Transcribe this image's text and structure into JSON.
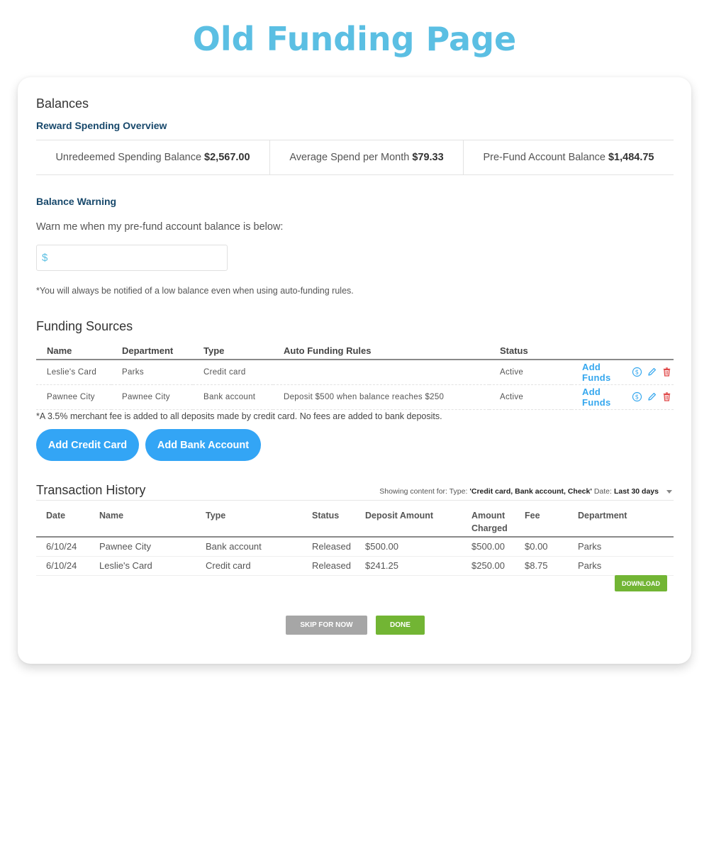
{
  "page": {
    "title": "Old Funding Page"
  },
  "colors": {
    "title": "#5bbfe3",
    "accent": "#33a5f5",
    "link": "#35a7ee",
    "subheading": "#17486b",
    "success": "#72b534",
    "neutral_button": "#a6a6a6",
    "danger": "#e04848"
  },
  "balances": {
    "heading": "Balances",
    "overview_heading": "Reward Spending Overview",
    "items": [
      {
        "label": "Unredeemed Spending Balance",
        "value": "$2,567.00"
      },
      {
        "label": "Average Spend per Month",
        "value": "$79.33"
      },
      {
        "label": "Pre-Fund Account Balance",
        "value": "$1,484.75"
      }
    ]
  },
  "balance_warning": {
    "heading": "Balance Warning",
    "label": "Warn me when my pre-fund account balance is below:",
    "currency_symbol": "$",
    "value": "",
    "note": "*You will always be notified of a low balance even when using auto-funding rules."
  },
  "funding_sources": {
    "heading": "Funding Sources",
    "columns": [
      "Name",
      "Department",
      "Type",
      "Auto Funding Rules",
      "Status"
    ],
    "rows": [
      {
        "name": "Leslie's Card",
        "department": "Parks",
        "type": "Credit card",
        "rules": "",
        "status": "Active",
        "action_label": "Add Funds"
      },
      {
        "name": "Pawnee City",
        "department": "Pawnee City",
        "type": "Bank account",
        "rules": "Deposit $500 when balance reaches $250",
        "status": "Active",
        "action_label": "Add Funds"
      }
    ],
    "icons": [
      "dollar-circle-icon",
      "pencil-icon",
      "trash-icon"
    ],
    "fee_note": "*A 3.5% merchant fee is added to all deposits made by credit card. No fees are added to bank deposits.",
    "add_credit_card_label": "Add Credit Card",
    "add_bank_account_label": "Add Bank Account"
  },
  "transactions": {
    "heading": "Transaction History",
    "filter": {
      "prefix": "Showing content for: Type:",
      "type_value": "'Credit card, Bank account, Check'",
      "date_label": "Date:",
      "date_value": "Last 30 days"
    },
    "columns": [
      "Date",
      "Name",
      "Type",
      "Status",
      "Deposit Amount",
      "Amount Charged",
      "Fee",
      "Department"
    ],
    "rows": [
      {
        "date": "6/10/24",
        "name": "Pawnee City",
        "type": "Bank account",
        "status": "Released",
        "deposit": "$500.00",
        "charged": "$500.00",
        "fee": "$0.00",
        "department": "Parks"
      },
      {
        "date": "6/10/24",
        "name": "Leslie's Card",
        "type": "Credit card",
        "status": "Released",
        "deposit": "$241.25",
        "charged": "$250.00",
        "fee": "$8.75",
        "department": "Parks"
      }
    ],
    "download_label": "DOWNLOAD"
  },
  "footer": {
    "skip_label": "SKIP FOR NOW",
    "done_label": "DONE"
  }
}
